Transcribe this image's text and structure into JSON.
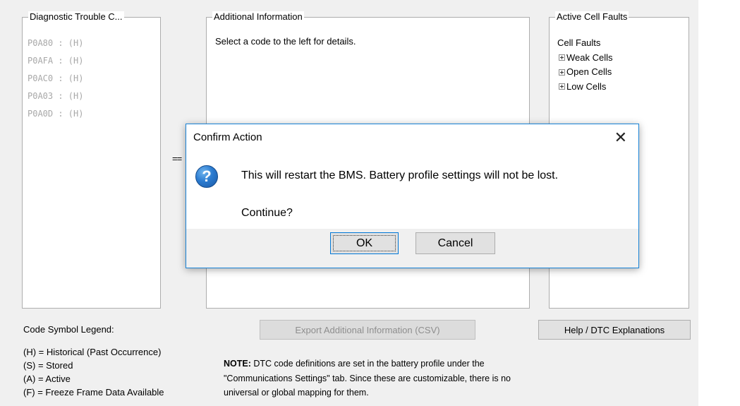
{
  "panels": {
    "dtc_title": "Diagnostic Trouble C...",
    "codes": [
      "P0A80 : (H)",
      "P0AFA : (H)",
      "P0AC0 : (H)",
      "P0A03 : (H)",
      "P0A0D : (H)"
    ],
    "additional_title": "Additional Information",
    "additional_text": "Select a code to the left for details.",
    "cells_title": "Active Cell Faults",
    "cells_root": "Cell Faults",
    "cells_children": [
      "Weak Cells",
      "Open Cells",
      "Low Cells"
    ]
  },
  "arrow_text": "==",
  "buttons": {
    "export": "Export Additional Information (CSV)",
    "help": "Help / DTC Explanations"
  },
  "legend": {
    "title": "Code Symbol Legend:",
    "items": [
      "(H) = Historical (Past Occurrence)",
      "(S) = Stored",
      "(A) = Active",
      "(F) = Freeze Frame Data Available"
    ]
  },
  "note": {
    "label": "NOTE:",
    "line1": " DTC code definitions are set in the battery profile under the",
    "line2": "\"Communications Settings\" tab. Since these are customizable, there is no",
    "line3": "universal or global mapping for them."
  },
  "dialog": {
    "title": "Confirm Action",
    "close_glyph": "✕",
    "icon_glyph": "?",
    "message": "This will restart the BMS. Battery profile settings will not be lost.",
    "continue": "Continue?",
    "ok": "OK",
    "cancel": "Cancel"
  }
}
